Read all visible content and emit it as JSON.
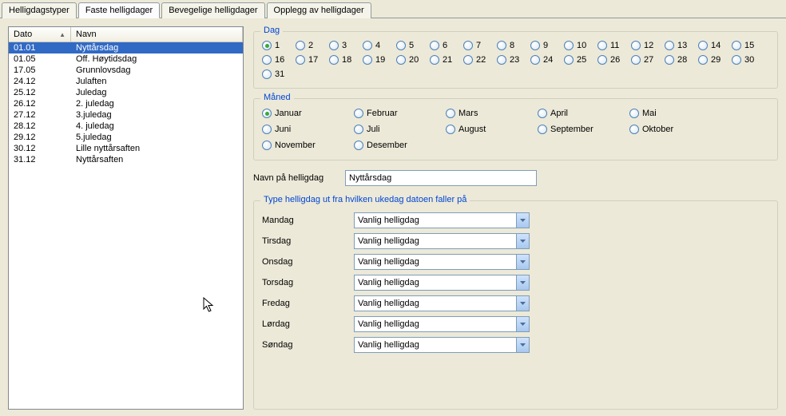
{
  "tabs": [
    {
      "label": "Helligdagstyper",
      "active": false
    },
    {
      "label": "Faste helligdager",
      "active": true
    },
    {
      "label": "Bevegelige helligdager",
      "active": false
    },
    {
      "label": "Opplegg av helligdager",
      "active": false
    }
  ],
  "list": {
    "header_dato": "Dato",
    "header_navn": "Navn",
    "rows": [
      {
        "dato": "01.01",
        "navn": "Nyttårsdag",
        "selected": true
      },
      {
        "dato": "01.05",
        "navn": "Off. Høytidsdag",
        "selected": false
      },
      {
        "dato": "17.05",
        "navn": "Grunnlovsdag",
        "selected": false
      },
      {
        "dato": "24.12",
        "navn": "Julaften",
        "selected": false
      },
      {
        "dato": "25.12",
        "navn": "Juledag",
        "selected": false
      },
      {
        "dato": "26.12",
        "navn": "2. juledag",
        "selected": false
      },
      {
        "dato": "27.12",
        "navn": "3.juledag",
        "selected": false
      },
      {
        "dato": "28.12",
        "navn": "4. juledag",
        "selected": false
      },
      {
        "dato": "29.12",
        "navn": "5.juledag",
        "selected": false
      },
      {
        "dato": "30.12",
        "navn": "Lille nyttårsaften",
        "selected": false
      },
      {
        "dato": "31.12",
        "navn": "Nyttårsaften",
        "selected": false
      }
    ]
  },
  "dag": {
    "legend": "Dag",
    "options": [
      "1",
      "2",
      "3",
      "4",
      "5",
      "6",
      "7",
      "8",
      "9",
      "10",
      "11",
      "12",
      "13",
      "14",
      "15",
      "16",
      "17",
      "18",
      "19",
      "20",
      "21",
      "22",
      "23",
      "24",
      "25",
      "26",
      "27",
      "28",
      "29",
      "30",
      "31"
    ],
    "selected": "1"
  },
  "maned": {
    "legend": "Måned",
    "options": [
      "Januar",
      "Februar",
      "Mars",
      "April",
      "Mai",
      "Juni",
      "Juli",
      "August",
      "September",
      "Oktober",
      "November",
      "Desember"
    ],
    "selected": "Januar"
  },
  "navn_field": {
    "label": "Navn på helligdag",
    "value": "Nyttårsdag"
  },
  "type_section": {
    "legend": "Type helligdag ut fra hvilken ukedag datoen faller på",
    "days": [
      {
        "label": "Mandag",
        "value": "Vanlig helligdag"
      },
      {
        "label": "Tirsdag",
        "value": "Vanlig helligdag"
      },
      {
        "label": "Onsdag",
        "value": "Vanlig helligdag"
      },
      {
        "label": "Torsdag",
        "value": "Vanlig helligdag"
      },
      {
        "label": "Fredag",
        "value": "Vanlig helligdag"
      },
      {
        "label": "Lørdag",
        "value": "Vanlig helligdag"
      },
      {
        "label": "Søndag",
        "value": "Vanlig helligdag"
      }
    ]
  }
}
